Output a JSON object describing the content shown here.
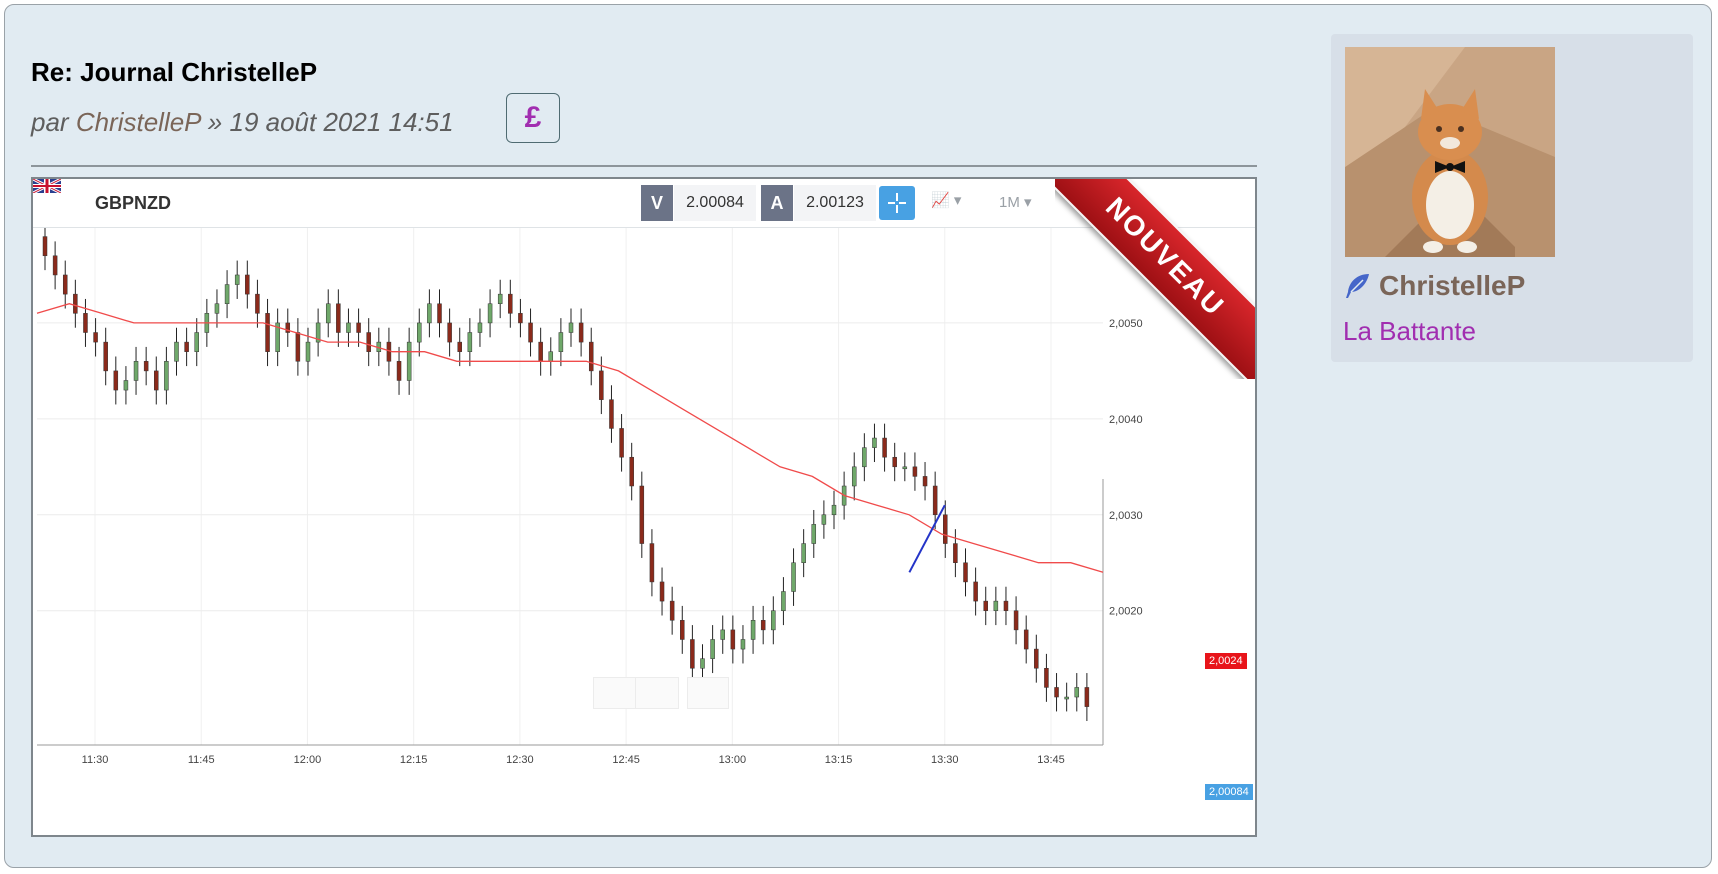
{
  "post": {
    "title": "Re: Journal ChristelleP",
    "meta_prefix": "par",
    "author": "ChristelleP",
    "date": "» 19 août 2021 14:51",
    "currency_symbol": "£"
  },
  "chart_widget": {
    "symbol": "GBPNZD",
    "bid_label": "V",
    "bid_value": "2.00084",
    "ask_label": "A",
    "ask_value": "2.00123",
    "period": "1M",
    "ribbon_text": "NOUVEAU",
    "current_ma_tag": "2,0024",
    "current_price_tag": "2,00084"
  },
  "chart_data": {
    "type": "candlestick",
    "xlabel": "",
    "ylabel": "",
    "x_ticks": [
      "11:30",
      "11:45",
      "12:00",
      "12:15",
      "12:30",
      "12:45",
      "13:00",
      "13:15",
      "13:30",
      "13:45"
    ],
    "y_ticks": [
      "2,0050",
      "2,0040",
      "2,0030",
      "2,0020"
    ],
    "y_tick_values": [
      2.005,
      2.004,
      2.003,
      2.002
    ],
    "ylim": [
      2.0006,
      2.006
    ],
    "grid": true,
    "series": [
      {
        "name": "",
        "type": "candles",
        "close_path": [
          2.0057,
          2.0055,
          2.0053,
          2.0051,
          2.0049,
          2.0048,
          2.0045,
          2.0043,
          2.0044,
          2.0046,
          2.0045,
          2.0043,
          2.0046,
          2.0048,
          2.0047,
          2.0049,
          2.0051,
          2.0052,
          2.0054,
          2.0055,
          2.0053,
          2.0051,
          2.0047,
          2.005,
          2.0049,
          2.0046,
          2.0048,
          2.005,
          2.0052,
          2.0049,
          2.005,
          2.0049,
          2.0047,
          2.0048,
          2.0046,
          2.0044,
          2.0048,
          2.005,
          2.0052,
          2.005,
          2.0048,
          2.0047,
          2.0049,
          2.005,
          2.0052,
          2.0053,
          2.0051,
          2.005,
          2.0048,
          2.0046,
          2.0047,
          2.0049,
          2.005,
          2.0048,
          2.0045,
          2.0042,
          2.0039,
          2.0036,
          2.0033,
          2.0027,
          2.0023,
          2.0021,
          2.0019,
          2.0017,
          2.0014,
          2.0015,
          2.0017,
          2.0018,
          2.0016,
          2.0017,
          2.0019,
          2.0018,
          2.002,
          2.0022,
          2.0025,
          2.0027,
          2.0029,
          2.003,
          2.0031,
          2.0033,
          2.0035,
          2.0037,
          2.0038,
          2.0036,
          2.0035,
          2.0035,
          2.0034,
          2.0033,
          2.003,
          2.0027,
          2.0025,
          2.0023,
          2.0021,
          2.002,
          2.0021,
          2.002,
          2.0018,
          2.0016,
          2.0014,
          2.0012,
          2.0011,
          2.0011,
          2.0012,
          2.001
        ]
      },
      {
        "name": "",
        "type": "moving-average",
        "values": [
          2.0051,
          2.0052,
          2.0051,
          2.005,
          2.005,
          2.005,
          2.005,
          2.005,
          2.0049,
          2.0048,
          2.0048,
          2.0047,
          2.0047,
          2.0046,
          2.0046,
          2.0046,
          2.0046,
          2.0046,
          2.0045,
          2.0043,
          2.0041,
          2.0039,
          2.0037,
          2.0035,
          2.0034,
          2.0032,
          2.0031,
          2.003,
          2.0028,
          2.0027,
          2.0026,
          2.0025,
          2.0025,
          2.0024
        ]
      }
    ],
    "annotation": {
      "type": "trendline",
      "from": [
        "13:25",
        2.0024
      ],
      "to": [
        "13:30",
        2.0031
      ]
    }
  },
  "sidebar": {
    "username": "ChristelleP",
    "rank": "La Battante"
  },
  "colors": {
    "bull": "#6fa86a",
    "bear": "#8b2a1b",
    "ma_line": "#f04b4b",
    "trend_line": "#2434c8",
    "rank": "#a12eb0",
    "author": "#7a6558"
  }
}
